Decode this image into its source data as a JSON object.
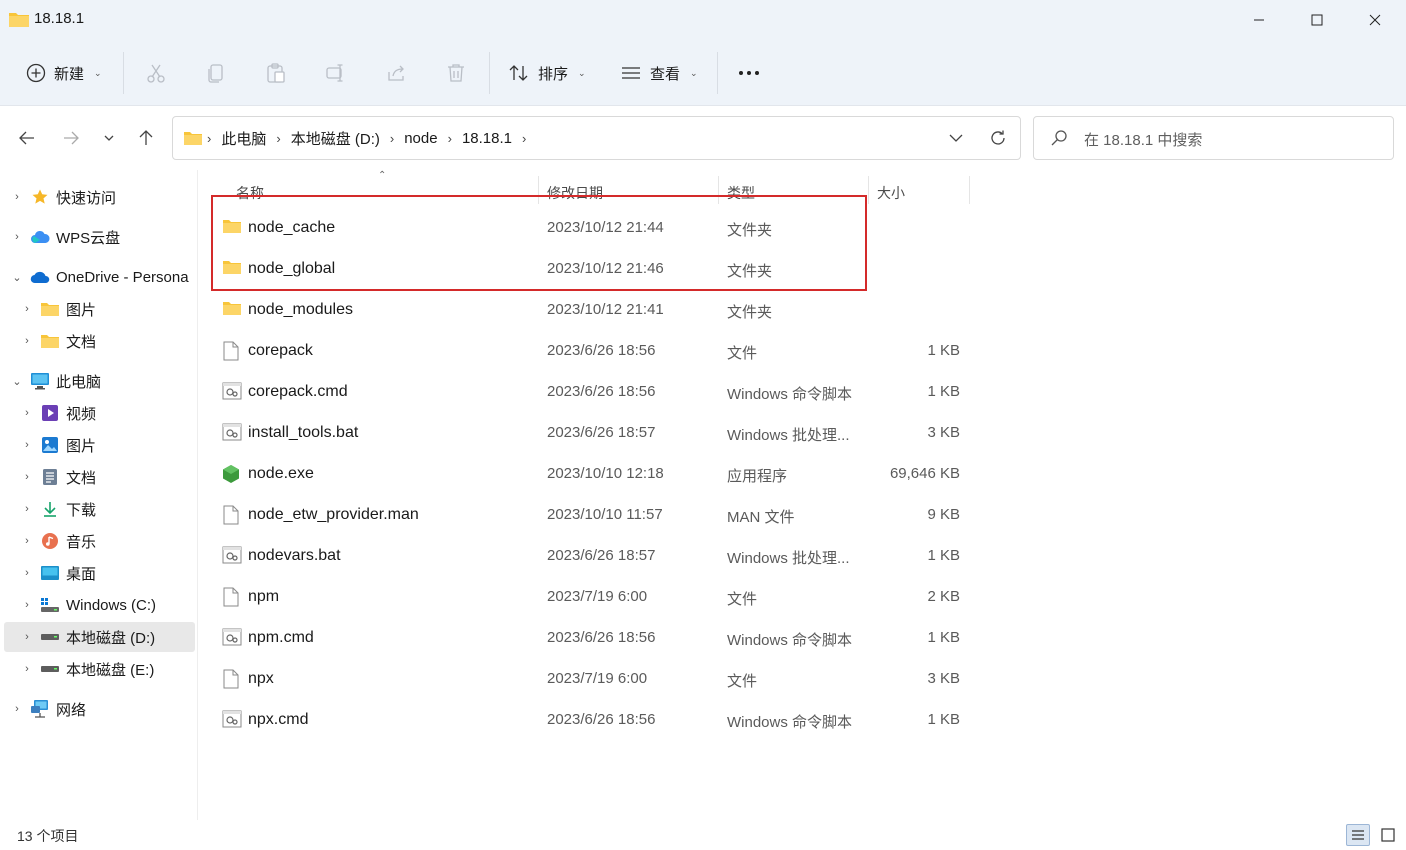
{
  "window": {
    "title": "18.18.1",
    "minimize_icon": "minimize-icon",
    "maximize_icon": "maximize-icon",
    "close_icon": "close-icon"
  },
  "toolbar": {
    "new_label": "新建",
    "sort_label": "排序",
    "view_label": "查看",
    "more_icon": "more-icon",
    "actions": [
      "cut-icon",
      "copy-icon",
      "paste-icon",
      "rename-icon",
      "share-icon",
      "delete-icon"
    ]
  },
  "address": {
    "breadcrumbs": [
      "此电脑",
      "本地磁盘 (D:)",
      "node",
      "18.18.1"
    ]
  },
  "search": {
    "placeholder": "在 18.18.1 中搜索"
  },
  "sidebar": {
    "items": [
      {
        "label": "快速访问",
        "icon": "star-icon",
        "expander": "collapsed"
      },
      {
        "label": "WPS云盘",
        "icon": "cloud-icon",
        "expander": "collapsed"
      },
      {
        "label": "OneDrive - Persona",
        "icon": "onedrive-icon",
        "expander": "expanded"
      },
      {
        "label": "图片",
        "icon": "folder-icon",
        "expander": "collapsed"
      },
      {
        "label": "文档",
        "icon": "folder-icon",
        "expander": "collapsed"
      },
      {
        "label": "此电脑",
        "icon": "pc-icon",
        "expander": "expanded"
      },
      {
        "label": "视频",
        "icon": "video-icon",
        "expander": "collapsed"
      },
      {
        "label": "图片",
        "icon": "pictures-icon",
        "expander": "collapsed"
      },
      {
        "label": "文档",
        "icon": "documents-icon",
        "expander": "collapsed"
      },
      {
        "label": "下载",
        "icon": "download-icon",
        "expander": "collapsed"
      },
      {
        "label": "音乐",
        "icon": "music-icon",
        "expander": "collapsed"
      },
      {
        "label": "桌面",
        "icon": "desktop-icon",
        "expander": "collapsed"
      },
      {
        "label": "Windows (C:)",
        "icon": "drive-c-icon",
        "expander": "collapsed"
      },
      {
        "label": "本地磁盘 (D:)",
        "icon": "drive-icon",
        "expander": "collapsed",
        "selected": true
      },
      {
        "label": "本地磁盘 (E:)",
        "icon": "drive-icon",
        "expander": "collapsed"
      },
      {
        "label": "网络",
        "icon": "network-icon",
        "expander": "collapsed"
      }
    ]
  },
  "columns": {
    "name": "名称",
    "date": "修改日期",
    "type": "类型",
    "size": "大小"
  },
  "files": [
    {
      "name": "node_cache",
      "date": "2023/10/12 21:44",
      "type": "文件夹",
      "size": "",
      "icon": "folder-icon"
    },
    {
      "name": "node_global",
      "date": "2023/10/12 21:46",
      "type": "文件夹",
      "size": "",
      "icon": "folder-icon"
    },
    {
      "name": "node_modules",
      "date": "2023/10/12 21:41",
      "type": "文件夹",
      "size": "",
      "icon": "folder-icon"
    },
    {
      "name": "corepack",
      "date": "2023/6/26 18:56",
      "type": "文件",
      "size": "1 KB",
      "icon": "file-icon"
    },
    {
      "name": "corepack.cmd",
      "date": "2023/6/26 18:56",
      "type": "Windows 命令脚本",
      "size": "1 KB",
      "icon": "script-icon"
    },
    {
      "name": "install_tools.bat",
      "date": "2023/6/26 18:57",
      "type": "Windows 批处理...",
      "size": "3 KB",
      "icon": "script-icon"
    },
    {
      "name": "node.exe",
      "date": "2023/10/10 12:18",
      "type": "应用程序",
      "size": "69,646 KB",
      "icon": "node-exe-icon"
    },
    {
      "name": "node_etw_provider.man",
      "date": "2023/10/10 11:57",
      "type": "MAN 文件",
      "size": "9 KB",
      "icon": "file-icon"
    },
    {
      "name": "nodevars.bat",
      "date": "2023/6/26 18:57",
      "type": "Windows 批处理...",
      "size": "1 KB",
      "icon": "script-icon"
    },
    {
      "name": "npm",
      "date": "2023/7/19 6:00",
      "type": "文件",
      "size": "2 KB",
      "icon": "file-icon"
    },
    {
      "name": "npm.cmd",
      "date": "2023/6/26 18:56",
      "type": "Windows 命令脚本",
      "size": "1 KB",
      "icon": "script-icon"
    },
    {
      "name": "npx",
      "date": "2023/7/19 6:00",
      "type": "文件",
      "size": "3 KB",
      "icon": "file-icon"
    },
    {
      "name": "npx.cmd",
      "date": "2023/6/26 18:56",
      "type": "Windows 命令脚本",
      "size": "1 KB",
      "icon": "script-icon"
    }
  ],
  "status": {
    "item_count": "13 个项目"
  },
  "colors": {
    "chrome_bg": "#eef3f9",
    "highlight_border": "#d42a2a",
    "folder_yellow": "#f8c53a",
    "selected_bg": "#e8e8e8"
  }
}
